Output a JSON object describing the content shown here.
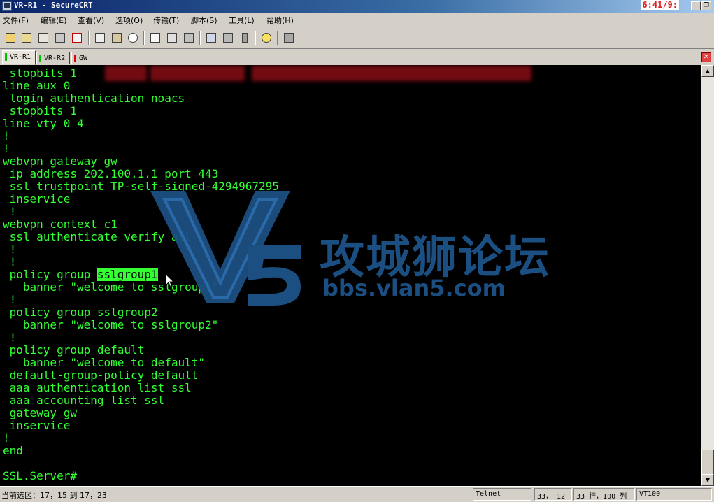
{
  "window": {
    "title": "VR-R1 - SecureCRT",
    "clock": "6:41/9:"
  },
  "menu": [
    "文件(F)",
    "编辑(E)",
    "查看(V)",
    "选项(O)",
    "传输(T)",
    "脚本(S)",
    "工具(L)",
    "帮助(H)"
  ],
  "toolbar_icons": [
    "connect-icon",
    "quick-connect-icon",
    "connect-tab-icon",
    "reconnect-icon",
    "disconnect-icon",
    "copy-icon",
    "paste-icon",
    "find-icon",
    "print-icon",
    "print-setup-icon",
    "printer-icon",
    "session-options-icon",
    "global-options-icon",
    "keymap-icon",
    "help-icon",
    "sftp-icon"
  ],
  "tabs": [
    {
      "label": "VR-R1",
      "status_color": "#00c000",
      "active": true
    },
    {
      "label": "VR-R2",
      "status_color": "#00c000",
      "active": false
    },
    {
      "label": "GW",
      "status_color": "#e00000",
      "active": false
    }
  ],
  "terminal": {
    "lines": [
      " stopbits 1",
      "line aux 0",
      " login authentication noacs",
      " stopbits 1",
      "line vty 0 4",
      "!",
      "!",
      "webvpn gateway gw",
      " ip address 202.100.1.1 port 443",
      " ssl trustpoint TP-self-signed-4294967295",
      " inservice",
      " !",
      "webvpn context c1",
      " ssl authenticate verify all",
      " !",
      " !",
      " policy group sslgroup1",
      "   banner \"welcome to sslgroup1\"",
      " !",
      " policy group sslgroup2",
      "   banner \"welcome to sslgroup2\"",
      " !",
      " policy group default",
      "   banner \"welcome to default\"",
      " default-group-policy default",
      " aaa authentication list ssl",
      " aaa accounting list ssl",
      " gateway gw",
      " inservice",
      "!",
      "end",
      "",
      "SSL.Server#"
    ],
    "highlight": {
      "line": 16,
      "prefix": " policy group ",
      "text": "sslgroup1"
    },
    "text_color": "#33ff33",
    "background": "#000000"
  },
  "watermark": {
    "cn_text": "攻城狮论坛",
    "url": "bbs.vlan5.com",
    "color": "#1b4f82"
  },
  "statusbar": {
    "selection": "当前选区：17，15 到 17，23",
    "protocol": "Telnet",
    "cursor": "33， 12",
    "size": "33 行，100 列",
    "terminal_type": "VT100"
  }
}
